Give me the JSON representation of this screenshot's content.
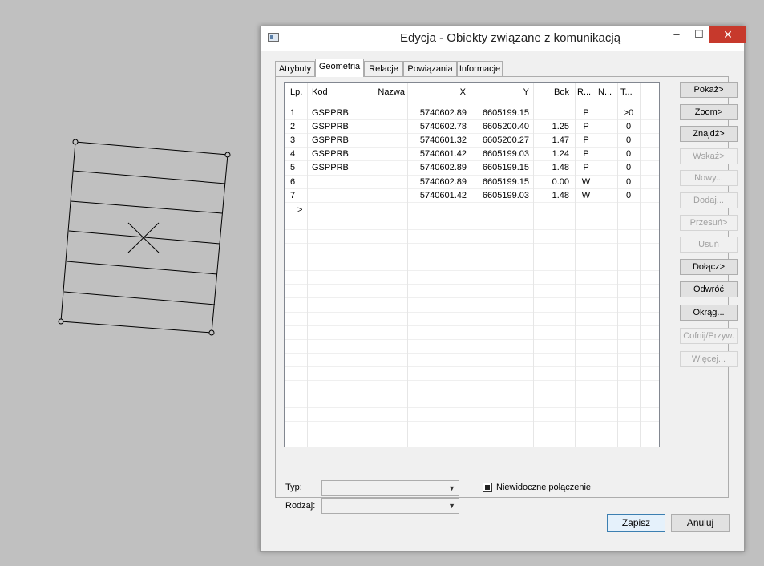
{
  "window": {
    "title": "Edycja - Obiekty związane z komunikacją",
    "minimize": "–",
    "maximize": "☐",
    "close": "✕"
  },
  "tabs": [
    "Atrybuty",
    "Geometria",
    "Relacje",
    "Powiązania",
    "Informacje"
  ],
  "active_tab": "Geometria",
  "grid": {
    "headers": [
      "Lp.",
      "Kod",
      "Nazwa",
      "X",
      "Y",
      "Bok",
      "R...",
      "N...",
      "T..."
    ],
    "rows": [
      {
        "lp": "1",
        "kod": "GSPPRB",
        "nazwa": "",
        "x": "5740602.89",
        "y": "6605199.15",
        "bok": "",
        "r": "P",
        "n": "",
        "t": ">0"
      },
      {
        "lp": "2",
        "kod": "GSPPRB",
        "nazwa": "",
        "x": "5740602.78",
        "y": "6605200.40",
        "bok": "1.25",
        "r": "P",
        "n": "",
        "t": "0"
      },
      {
        "lp": "3",
        "kod": "GSPPRB",
        "nazwa": "",
        "x": "5740601.32",
        "y": "6605200.27",
        "bok": "1.47",
        "r": "P",
        "n": "",
        "t": "0"
      },
      {
        "lp": "4",
        "kod": "GSPPRB",
        "nazwa": "",
        "x": "5740601.42",
        "y": "6605199.03",
        "bok": "1.24",
        "r": "P",
        "n": "",
        "t": "0"
      },
      {
        "lp": "5",
        "kod": "GSPPRB",
        "nazwa": "",
        "x": "5740602.89",
        "y": "6605199.15",
        "bok": "1.48",
        "r": "P",
        "n": "",
        "t": "0"
      },
      {
        "lp": "6",
        "kod": "",
        "nazwa": "",
        "x": "5740602.89",
        "y": "6605199.15",
        "bok": "0.00",
        "r": "W",
        "n": "",
        "t": "0"
      },
      {
        "lp": "7",
        "kod": "",
        "nazwa": "",
        "x": "5740601.42",
        "y": "6605199.03",
        "bok": "1.48",
        "r": "W",
        "n": "",
        "t": "0"
      }
    ],
    "new_row_marker": ">"
  },
  "side_buttons": [
    {
      "label": "Pokaż>",
      "enabled": true
    },
    {
      "label": "Zoom>",
      "enabled": true
    },
    {
      "label": "Znajdź>",
      "enabled": true
    },
    {
      "label": "Wskaż>",
      "enabled": false
    },
    {
      "label": "Nowy...",
      "enabled": false
    },
    {
      "label": "Dodaj...",
      "enabled": false
    },
    {
      "label": "Przesuń>",
      "enabled": false
    },
    {
      "label": "Usuń",
      "enabled": false
    },
    {
      "label": "Dołącz>",
      "enabled": true
    },
    {
      "label": "Odwróć",
      "enabled": true
    },
    {
      "label": "Okrąg...",
      "enabled": true
    },
    {
      "label": "Cofnij/Przyw.",
      "enabled": false
    },
    {
      "label": "Więcej...",
      "enabled": false
    }
  ],
  "form": {
    "typ_label": "Typ:",
    "rodzaj_label": "Rodzaj:",
    "typ_value": "",
    "rodzaj_value": "",
    "checkbox_label": "Niewidoczne połączenie",
    "checkbox_checked": true
  },
  "footer": {
    "save": "Zapisz",
    "cancel": "Anuluj"
  }
}
